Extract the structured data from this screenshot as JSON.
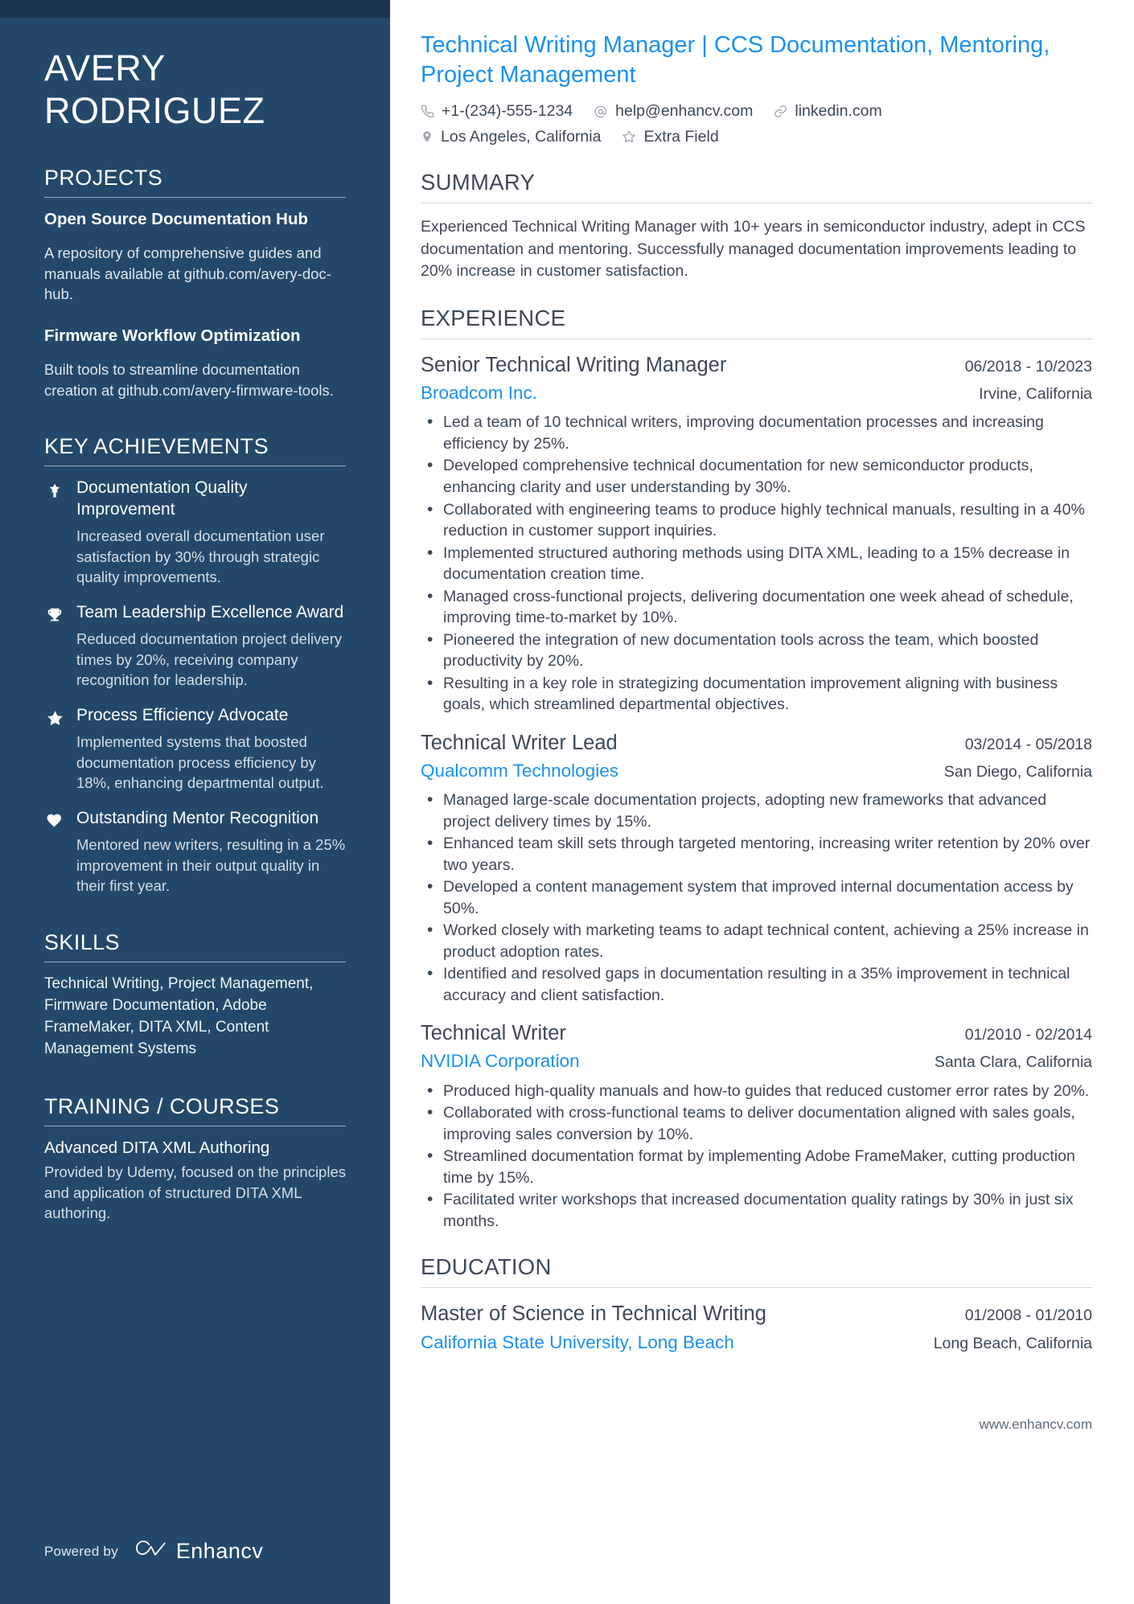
{
  "sidebar": {
    "name": "AVERY RODRIGUEZ",
    "projects": {
      "title": "PROJECTS",
      "items": [
        {
          "name": "Open Source Documentation Hub",
          "description": "A repository of comprehensive guides and manuals available at github.com/avery-doc-hub."
        },
        {
          "name": "Firmware Workflow Optimization",
          "description": "Built tools to streamline documentation creation at github.com/avery-firmware-tools."
        }
      ]
    },
    "achievements": {
      "title": "KEY ACHIEVEMENTS",
      "items": [
        {
          "icon": "bookmark-star-icon",
          "title": "Documentation Quality Improvement",
          "description": "Increased overall documentation user satisfaction by 30% through strategic quality improvements."
        },
        {
          "icon": "trophy-icon",
          "title": "Team Leadership Excellence Award",
          "description": "Reduced documentation project delivery times by 20%, receiving company recognition for leadership."
        },
        {
          "icon": "star-icon",
          "title": "Process Efficiency Advocate",
          "description": "Implemented systems that boosted documentation process efficiency by 18%, enhancing departmental output."
        },
        {
          "icon": "heart-icon",
          "title": "Outstanding Mentor Recognition",
          "description": "Mentored new writers, resulting in a 25% improvement in their output quality in their first year."
        }
      ]
    },
    "skills": {
      "title": "SKILLS",
      "text": "Technical Writing, Project Management, Firmware Documentation, Adobe FrameMaker, DITA XML, Content Management Systems"
    },
    "training": {
      "title": "TRAINING / COURSES",
      "items": [
        {
          "name": "Advanced DITA XML Authoring",
          "description": "Provided by Udemy, focused on the principles and application of structured DITA XML authoring."
        }
      ]
    },
    "footer": {
      "powered_by": "Powered by",
      "brand": "Enhancv",
      "logo_icon": "enhancv-logo-icon"
    }
  },
  "main": {
    "headline": "Technical Writing Manager | CCS Documentation, Mentoring, Project Management",
    "contacts": [
      [
        {
          "icon": "phone-icon",
          "text": "+1-(234)-555-1234"
        },
        {
          "icon": "email-at-icon",
          "text": "help@enhancv.com"
        },
        {
          "icon": "link-icon",
          "text": "linkedin.com"
        }
      ],
      [
        {
          "icon": "location-pin-icon",
          "text": "Los Angeles, California"
        },
        {
          "icon": "star-outline-icon",
          "text": "Extra Field"
        }
      ]
    ],
    "summary": {
      "title": "SUMMARY",
      "text": "Experienced Technical Writing Manager with 10+ years in semiconductor industry, adept in CCS documentation and mentoring. Successfully managed documentation improvements leading to 20% increase in customer satisfaction."
    },
    "experience": {
      "title": "EXPERIENCE",
      "entries": [
        {
          "role": "Senior Technical Writing Manager",
          "date": "06/2018 - 10/2023",
          "company": "Broadcom Inc.",
          "location": "Irvine, California",
          "bullets": [
            "Led a team of 10 technical writers, improving documentation processes and increasing efficiency by 25%.",
            "Developed comprehensive technical documentation for new semiconductor products, enhancing clarity and user understanding by 30%.",
            "Collaborated with engineering teams to produce highly technical manuals, resulting in a 40% reduction in customer support inquiries.",
            "Implemented structured authoring methods using DITA XML, leading to a 15% decrease in documentation creation time.",
            "Managed cross-functional projects, delivering documentation one week ahead of schedule, improving time-to-market by 10%.",
            "Pioneered the integration of new documentation tools across the team, which boosted productivity by 20%.",
            "Resulting in a key role in strategizing documentation improvement aligning with business goals, which streamlined departmental objectives."
          ]
        },
        {
          "role": "Technical Writer Lead",
          "date": "03/2014 - 05/2018",
          "company": "Qualcomm Technologies",
          "location": "San Diego, California",
          "bullets": [
            "Managed large-scale documentation projects, adopting new frameworks that advanced project delivery times by 15%.",
            "Enhanced team skill sets through targeted mentoring, increasing writer retention by 20% over two years.",
            "Developed a content management system that improved internal documentation access by 50%.",
            "Worked closely with marketing teams to adapt technical content, achieving a 25% increase in product adoption rates.",
            "Identified and resolved gaps in documentation resulting in a 35% improvement in technical accuracy and client satisfaction."
          ]
        },
        {
          "role": "Technical Writer",
          "date": "01/2010 - 02/2014",
          "company": "NVIDIA Corporation",
          "location": "Santa Clara, California",
          "bullets": [
            "Produced high-quality manuals and how-to guides that reduced customer error rates by 20%.",
            "Collaborated with cross-functional teams to deliver documentation aligned with sales goals, improving sales conversion by 10%.",
            "Streamlined documentation format by implementing Adobe FrameMaker, cutting production time by 15%.",
            "Facilitated writer workshops that increased documentation quality ratings by 30% in just six months."
          ]
        }
      ]
    },
    "education": {
      "title": "EDUCATION",
      "entries": [
        {
          "degree": "Master of Science in Technical Writing",
          "date": "01/2008 - 01/2010",
          "school": "California State University, Long Beach",
          "location": "Long Beach, California"
        }
      ]
    },
    "footer_url": "www.enhancv.com"
  },
  "colors": {
    "sidebar_bg": "#24486a",
    "sidebar_topbar": "#1b3450",
    "accent_blue": "#1a91f0",
    "body_text": "#3c4a57"
  }
}
